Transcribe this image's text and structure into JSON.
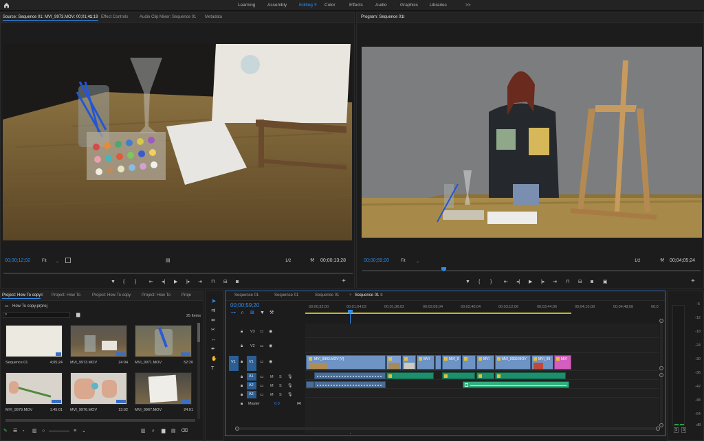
{
  "workspaces": {
    "items": [
      "Learning",
      "Assembly",
      "Editing",
      "Color",
      "Effects",
      "Audio",
      "Graphics",
      "Libraries"
    ],
    "active": "Editing",
    "more_icon": ">>"
  },
  "source": {
    "tabs": [
      "Source: Sequence 01: MVI_9973.MOV: 00;01;41;19",
      "Effect Controls",
      "Audio Clip Mixer: Sequence 01",
      "Metadata"
    ],
    "timecode_left": "00;00;12;02",
    "fit": "Fit",
    "resolution": "1/2",
    "timecode_right": "00;00;13;28"
  },
  "program": {
    "tab": "Program: Sequence 01",
    "timecode_left": "00;00;59;20",
    "fit": "Fit",
    "resolution": "1/2",
    "timecode_right": "00;04;05;24"
  },
  "project": {
    "tabs": [
      "Project: How To copy",
      "Project: How To",
      "Project: How To copy",
      "Project: How To",
      "Proje"
    ],
    "file": "How To copy.prproj",
    "items_count": "25 Items",
    "clips": [
      {
        "name": "Sequence 01",
        "duration": "4;05;24"
      },
      {
        "name": "MVI_9973.MOV",
        "duration": "24:04"
      },
      {
        "name": "MVI_9971.MOV",
        "duration": "52:20"
      },
      {
        "name": "MVI_9979.MOV",
        "duration": "1:45:01"
      },
      {
        "name": "MVI_9976.MOV",
        "duration": "13:02"
      },
      {
        "name": "MVI_9967.MOV",
        "duration": "24:01"
      }
    ]
  },
  "timeline": {
    "tabs": [
      "Sequence 01",
      "Sequence 01",
      "Sequence 01",
      "Sequence 01"
    ],
    "timecode": "00;00;59;20",
    "ruler": [
      "00;00;32;00",
      "00;01;04;02",
      "00;01;36;02",
      "00;02;08;04",
      "00;02;40;04",
      "00;03;12;06",
      "00;03;44;06",
      "00;04;16;08",
      "00;04;48;08",
      "00;0"
    ],
    "tracks": {
      "v3": "V3",
      "v2": "V2",
      "v1": "V1",
      "src_v1": "V1",
      "a1": "A1",
      "a2": "A2",
      "a3": "A3",
      "master": "Master",
      "master_val": "0.0",
      "m": "M",
      "s": "S"
    },
    "clips": {
      "c1": "MVI_9993.MOV [V]",
      "c2": "MVI",
      "c3": "MVI_9",
      "c4": "MVI",
      "c5": "MVI_9993.MOV",
      "c6": "MVI_99",
      "c7": "MVI"
    }
  },
  "meter": {
    "scale": [
      "-6",
      "-12",
      "-18",
      "-24",
      "-30",
      "-36",
      "-42",
      "-48",
      "-54",
      "dB"
    ],
    "solo": "S"
  }
}
